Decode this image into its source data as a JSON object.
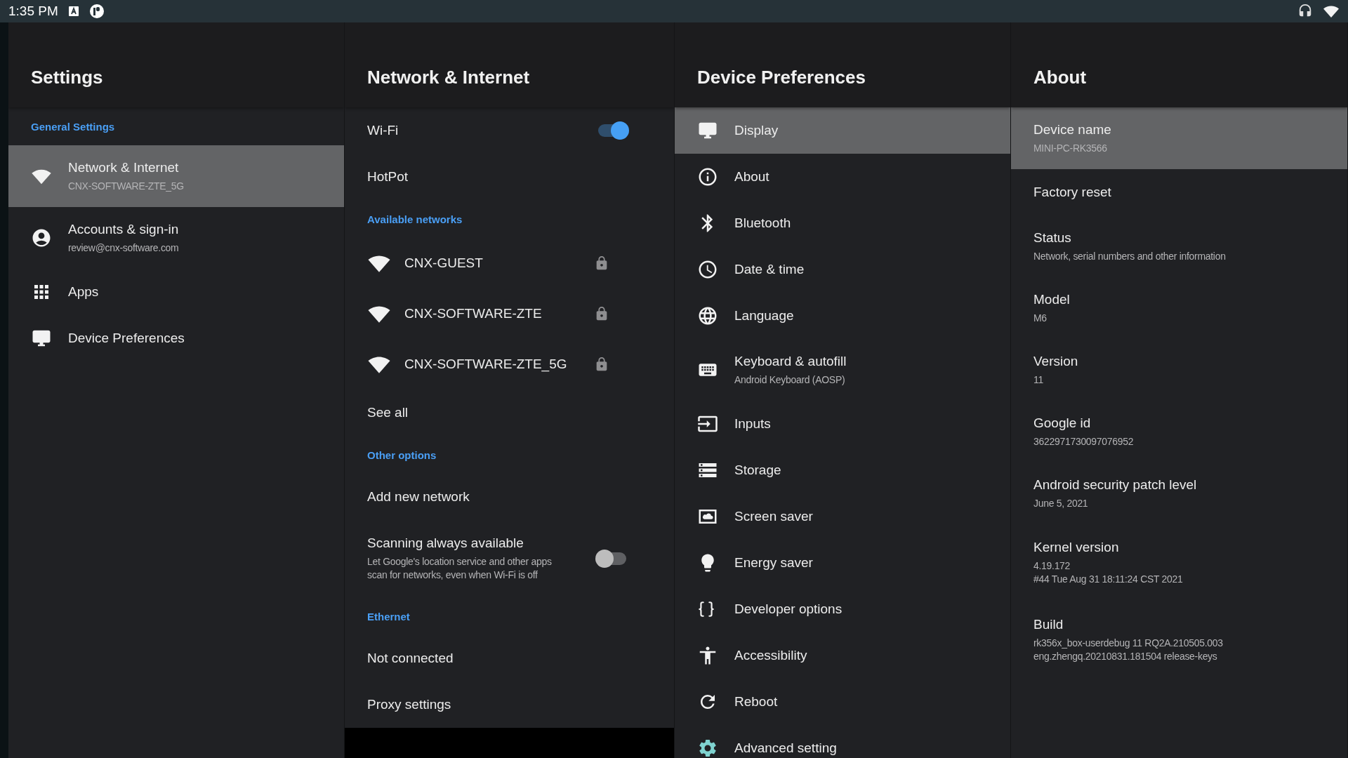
{
  "status_bar": {
    "time": "1:35 PM"
  },
  "panels": [
    {
      "title": "Settings",
      "items": [
        {
          "kind": "section",
          "label": "General Settings"
        },
        {
          "kind": "item",
          "title": "Network & Internet",
          "subtitle": "CNX-SOFTWARE-ZTE_5G",
          "selected": true
        },
        {
          "kind": "item",
          "title": "Accounts & sign-in",
          "subtitle": "review@cnx-software.com",
          "selected": false
        },
        {
          "kind": "item",
          "title": "Apps",
          "selected": false
        },
        {
          "kind": "item",
          "title": "Device Preferences",
          "selected": false
        }
      ]
    },
    {
      "title": "Network & Internet",
      "items": [
        {
          "kind": "toggle",
          "title": "Wi-Fi",
          "on": true,
          "selected": false
        },
        {
          "kind": "item",
          "title": "HotPot",
          "selected": false
        },
        {
          "kind": "section",
          "label": "Available networks"
        },
        {
          "kind": "network",
          "title": "CNX-GUEST",
          "locked": true,
          "selected": false
        },
        {
          "kind": "network",
          "title": "CNX-SOFTWARE-ZTE",
          "locked": true,
          "selected": false
        },
        {
          "kind": "network",
          "title": "CNX-SOFTWARE-ZTE_5G",
          "locked": true,
          "selected": false
        },
        {
          "kind": "item",
          "title": "See all",
          "selected": false
        },
        {
          "kind": "section",
          "label": "Other options"
        },
        {
          "kind": "item",
          "title": "Add new network",
          "selected": false
        },
        {
          "kind": "toggle",
          "title": "Scanning always available",
          "subtitle": "Let Google's location service and other apps\nscan for networks, even when Wi-Fi is off",
          "on": false,
          "selected": false
        },
        {
          "kind": "section",
          "label": "Ethernet"
        },
        {
          "kind": "item",
          "title": "Not connected",
          "selected": false
        },
        {
          "kind": "item",
          "title": "Proxy settings",
          "selected": false
        }
      ]
    },
    {
      "title": "Device Preferences",
      "items": [
        {
          "kind": "item",
          "title": "Display",
          "selected": true
        },
        {
          "kind": "item",
          "title": "About",
          "selected": false
        },
        {
          "kind": "item",
          "title": "Bluetooth",
          "selected": false
        },
        {
          "kind": "item",
          "title": "Date & time",
          "selected": false
        },
        {
          "kind": "item",
          "title": "Language",
          "selected": false
        },
        {
          "kind": "item",
          "title": "Keyboard & autofill",
          "subtitle": "Android Keyboard (AOSP)",
          "selected": false
        },
        {
          "kind": "item",
          "title": "Inputs",
          "selected": false
        },
        {
          "kind": "item",
          "title": "Storage",
          "selected": false
        },
        {
          "kind": "item",
          "title": "Screen saver",
          "selected": false
        },
        {
          "kind": "item",
          "title": "Energy saver",
          "selected": false
        },
        {
          "kind": "item",
          "title": "Developer options",
          "selected": false
        },
        {
          "kind": "item",
          "title": "Accessibility",
          "selected": false
        },
        {
          "kind": "item",
          "title": "Reboot",
          "selected": false
        },
        {
          "kind": "item",
          "title": "Advanced setting",
          "selected": false
        }
      ]
    },
    {
      "title": "About",
      "items": [
        {
          "kind": "item",
          "title": "Device name",
          "subtitle": "MINI-PC-RK3566",
          "selected": true
        },
        {
          "kind": "item",
          "title": "Factory reset",
          "selected": false
        },
        {
          "kind": "item",
          "title": "Status",
          "subtitle": "Network, serial numbers and other information",
          "selected": false
        },
        {
          "kind": "item",
          "title": "Model",
          "subtitle": "M6",
          "selected": false
        },
        {
          "kind": "item",
          "title": "Version",
          "subtitle": "11",
          "selected": false
        },
        {
          "kind": "item",
          "title": "Google id",
          "subtitle": "3622971730097076952",
          "selected": false
        },
        {
          "kind": "item",
          "title": "Android security patch level",
          "subtitle": "June 5, 2021",
          "selected": false
        },
        {
          "kind": "item",
          "title": "Kernel version",
          "subtitle": "4.19.172\n#44 Tue Aug 31 18:11:24 CST 2021",
          "selected": false
        },
        {
          "kind": "item",
          "title": "Build",
          "subtitle": "rk356x_box-userdebug 11 RQ2A.210505.003\neng.zhengq.20210831.181504 release-keys",
          "selected": false
        }
      ]
    }
  ]
}
